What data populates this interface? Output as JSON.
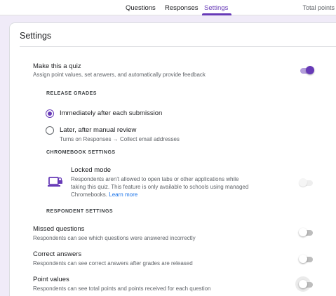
{
  "header": {
    "tabs": [
      {
        "label": "Questions"
      },
      {
        "label": "Responses"
      },
      {
        "label": "Settings"
      }
    ],
    "total_points": "Total points"
  },
  "settings": {
    "title": "Settings",
    "quiz": {
      "title": "Make this a quiz",
      "description": "Assign point values, set answers, and automatically provide feedback",
      "enabled": true
    },
    "release_grades": {
      "heading": "RELEASE GRADES",
      "options": [
        {
          "label": "Immediately after each submission",
          "selected": true
        },
        {
          "label": "Later, after manual review",
          "sublabel": "Turns on Responses → Collect email addresses",
          "selected": false
        }
      ]
    },
    "chromebook": {
      "heading": "CHROMEBOOK SETTINGS",
      "icon": "laptop-lock-icon",
      "title": "Locked mode",
      "description_lines": [
        "Respondents aren't allowed to open tabs or other applications while",
        "taking this quiz. This feature is only available to schools using managed"
      ],
      "description_tail": "Chromebooks.",
      "learn_more": "Learn more",
      "enabled": false
    },
    "respondent": {
      "heading": "RESPONDENT SETTINGS",
      "items": [
        {
          "title": "Missed questions",
          "description": "Respondents can see which questions were answered incorrectly",
          "enabled": false
        },
        {
          "title": "Correct answers",
          "description": "Respondents can see correct answers after grades are released",
          "enabled": false
        },
        {
          "title": "Point values",
          "description": "Respondents can see total points and points received for each question",
          "enabled": false
        }
      ]
    }
  },
  "colors": {
    "accent": "#673ab7",
    "background": "#f0ebf8",
    "link": "#1a73e8"
  }
}
